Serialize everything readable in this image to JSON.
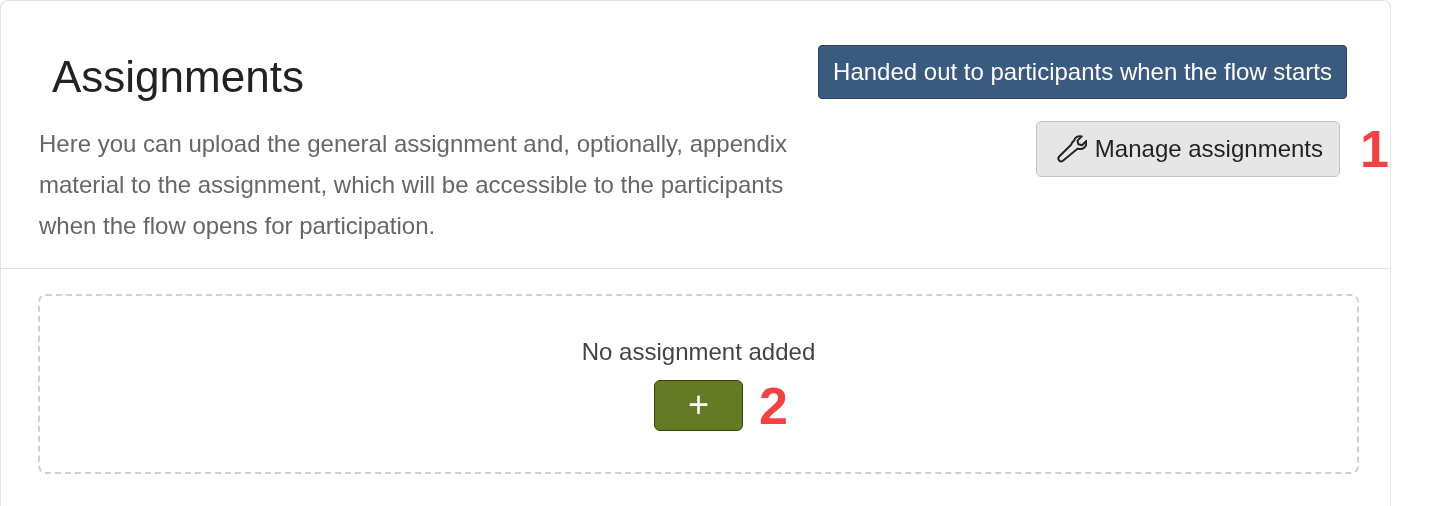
{
  "title": "Assignments",
  "badge": "Handed out to participants when the flow starts",
  "description": "Here you can upload the general assignment and, optionally, appendix material to the assignment, which will be accessible to the participants when the flow opens for participation.",
  "manage_button": {
    "label": "Manage assignments",
    "annotation": "1"
  },
  "empty_state": {
    "message": "No assignment added",
    "add_button": "+",
    "annotation": "2"
  }
}
